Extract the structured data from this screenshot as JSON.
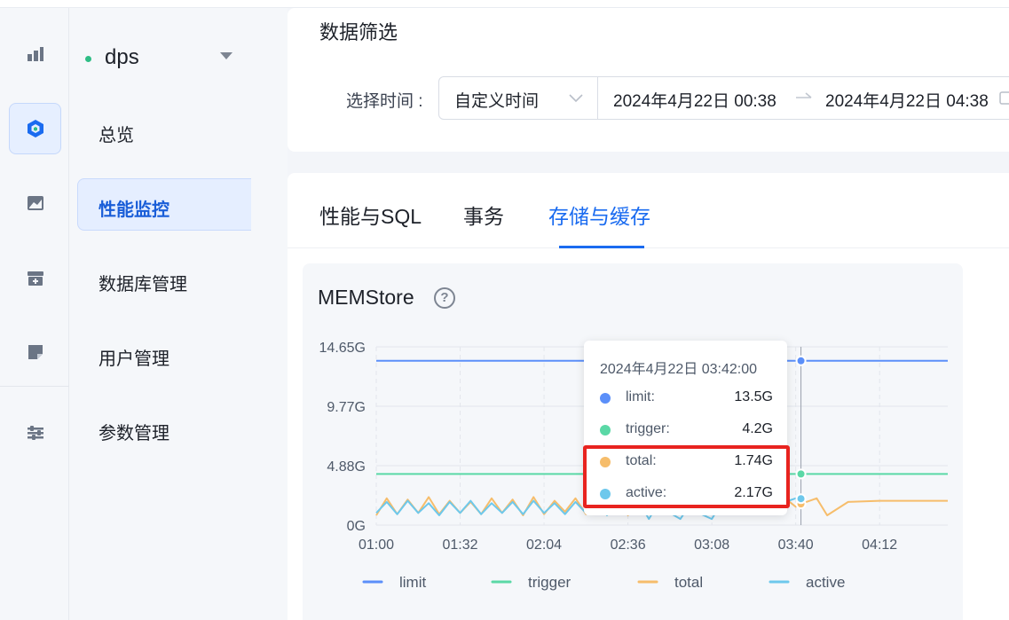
{
  "db": {
    "name": "dps"
  },
  "nav": {
    "items": [
      {
        "label": "总览"
      },
      {
        "label": "性能监控"
      },
      {
        "label": "数据库管理"
      },
      {
        "label": "用户管理"
      },
      {
        "label": "参数管理"
      }
    ],
    "active": "性能监控"
  },
  "rail": {
    "icons": [
      "bar-chart-icon",
      "cube-icon",
      "area-chart-icon",
      "archive-icon",
      "note-icon",
      "sliders-icon"
    ],
    "active": "cube-icon"
  },
  "filter": {
    "title": "数据筛选",
    "time_label": "选择时间 :",
    "select_value": "自定义时间",
    "range_start": "2024年4月22日 00:38",
    "range_end": "2024年4月22日 04:38"
  },
  "tabs": [
    {
      "label": "性能与SQL"
    },
    {
      "label": "事务"
    },
    {
      "label": "存储与缓存"
    }
  ],
  "active_tab": "存储与缓存",
  "chart": {
    "title": "MEMStore"
  },
  "tooltip": {
    "time": "2024年4月22日 03:42:00",
    "rows": [
      {
        "name": "limit:",
        "value": "13.5G"
      },
      {
        "name": "trigger:",
        "value": "4.2G"
      },
      {
        "name": "total:",
        "value": "1.74G"
      },
      {
        "name": "active:",
        "value": "2.17G"
      }
    ]
  },
  "colors": {
    "accent": "#1a6bf0",
    "limit": "#5b8ff9",
    "trigger": "#5ad8a6",
    "total": "#f6bd6b",
    "active": "#6dc8ec",
    "highlight": "#e8231f"
  },
  "chart_data": {
    "type": "line",
    "title": "MEMStore",
    "x_ticks": [
      "01:00",
      "01:32",
      "02:04",
      "02:36",
      "03:08",
      "03:40",
      "04:12"
    ],
    "y_ticks": [
      "14.65G",
      "9.77G",
      "4.88G",
      "0G"
    ],
    "ylim": [
      0,
      14.65
    ],
    "y_unit": "G",
    "x_range": [
      "01:00",
      "04:38"
    ],
    "grid": true,
    "legend_position": "bottom",
    "series": [
      {
        "name": "limit",
        "x": [
          "01:00",
          "04:38"
        ],
        "values": [
          13.5,
          13.5
        ]
      },
      {
        "name": "trigger",
        "x": [
          "01:00",
          "04:38"
        ],
        "values": [
          4.2,
          4.2
        ]
      },
      {
        "name": "total",
        "x": [
          "01:00",
          "01:04",
          "01:08",
          "01:12",
          "01:16",
          "01:20",
          "01:24",
          "01:28",
          "01:32",
          "01:36",
          "01:40",
          "01:44",
          "01:48",
          "01:52",
          "01:56",
          "02:00",
          "02:04",
          "02:08",
          "02:12",
          "02:16",
          "02:20",
          "02:24",
          "02:28",
          "02:32",
          "02:36",
          "02:40",
          "02:44",
          "02:48",
          "02:52",
          "02:56",
          "03:00",
          "03:04",
          "03:08",
          "03:12",
          "03:16",
          "03:20",
          "03:24",
          "03:28",
          "03:32",
          "03:36",
          "03:40",
          "03:42",
          "03:48",
          "03:52",
          "04:00",
          "04:12",
          "04:24",
          "04:38"
        ],
        "values": [
          0.8,
          2.2,
          0.9,
          2.1,
          1.0,
          2.3,
          0.9,
          2.0,
          1.0,
          1.9,
          0.9,
          2.2,
          1.0,
          2.1,
          0.8,
          2.3,
          0.9,
          2.0,
          1.1,
          2.2,
          0.9,
          2.1,
          1.0,
          2.2,
          0.8,
          2.1,
          1.0,
          2.3,
          0.9,
          2.0,
          1.1,
          2.2,
          0.9,
          2.1,
          1.0,
          2.2,
          0.9,
          2.0,
          1.0,
          2.2,
          1.5,
          1.74,
          2.2,
          0.8,
          1.9,
          2.0,
          2.0,
          2.0
        ]
      },
      {
        "name": "active",
        "x": [
          "01:00",
          "01:04",
          "01:08",
          "01:12",
          "01:16",
          "01:20",
          "01:24",
          "01:28",
          "01:32",
          "01:36",
          "01:40",
          "01:44",
          "01:48",
          "01:52",
          "01:56",
          "02:00",
          "02:04",
          "02:08",
          "02:12",
          "02:16",
          "02:20",
          "02:24",
          "02:28",
          "02:32",
          "02:36",
          "02:40",
          "02:44",
          "02:48",
          "02:52",
          "02:56",
          "03:00",
          "03:04",
          "03:08",
          "03:12",
          "03:16",
          "03:20",
          "03:24",
          "03:28",
          "03:32",
          "03:36",
          "03:40",
          "03:42"
        ],
        "values": [
          1.0,
          1.9,
          0.9,
          2.0,
          1.0,
          1.8,
          0.8,
          1.9,
          1.0,
          2.0,
          0.9,
          1.8,
          1.0,
          1.9,
          0.9,
          2.0,
          1.0,
          1.8,
          0.9,
          1.9,
          1.0,
          2.0,
          0.8,
          1.9,
          0.9,
          2.0,
          0.5,
          1.9,
          1.0,
          0.5,
          1.8,
          0.9,
          0.5,
          1.9,
          1.0,
          1.8,
          0.9,
          2.0,
          1.0,
          1.9,
          2.2,
          2.17
        ]
      }
    ]
  }
}
